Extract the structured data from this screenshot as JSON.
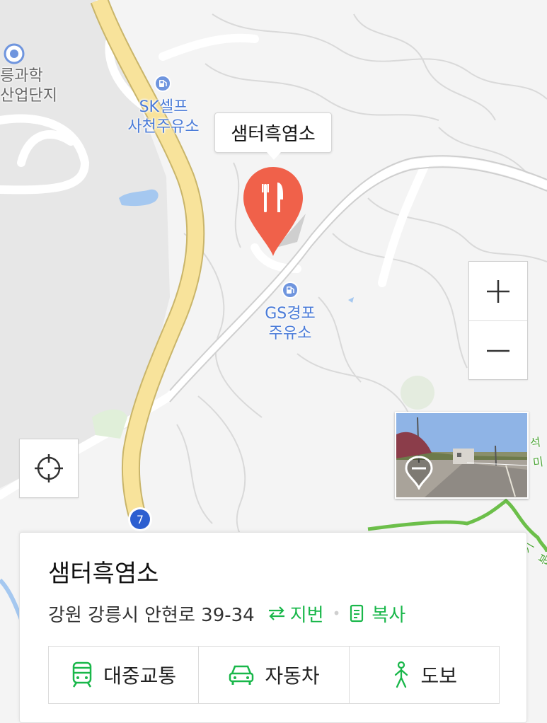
{
  "map": {
    "area_label_line1": "릉과학",
    "area_label_line2": "산업단지",
    "poi_sk_line1": "SK셀프",
    "poi_sk_line2": "사천주유소",
    "poi_gs_line1": "GS경포",
    "poi_gs_line2": "주유소",
    "trail_label_1": "석미",
    "trail_label_2": "-기분",
    "route_number": "7",
    "selected_place_callout": "샘터흑염소"
  },
  "controls": {
    "zoom_in_icon": "plus-icon",
    "zoom_out_icon": "minus-icon",
    "locate_icon": "crosshair-icon",
    "roadview_icon": "roadview-pin-icon"
  },
  "place_card": {
    "name": "샘터흑염소",
    "address": "강원 강릉시 안현로 39-34",
    "lot_number_label": "지번",
    "copy_label": "복사",
    "transport_modes": [
      {
        "label": "대중교통",
        "icon": "train-icon"
      },
      {
        "label": "자동차",
        "icon": "car-icon"
      },
      {
        "label": "도보",
        "icon": "walking-icon"
      }
    ]
  },
  "colors": {
    "pin_red": "#f0614a",
    "accent_green": "#19b74a",
    "highway_yellow": "#f8e39b",
    "poi_blue": "#4a7bd8",
    "trail_green": "#6cbf4a"
  }
}
